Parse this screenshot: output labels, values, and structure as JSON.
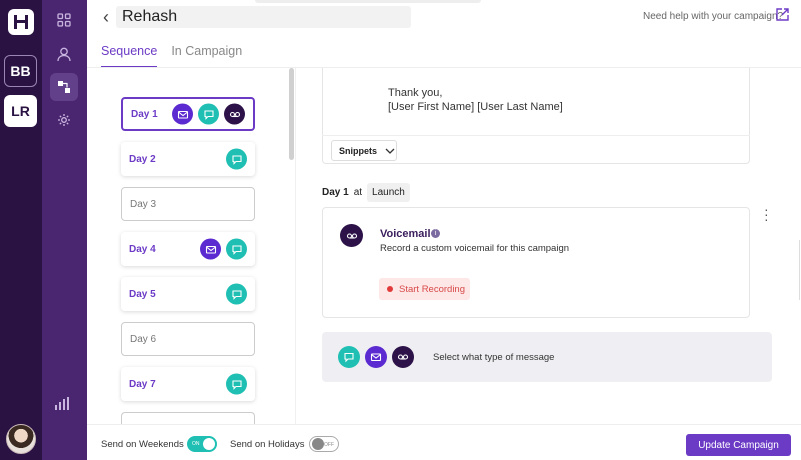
{
  "rail": {
    "workspaces": [
      "BB",
      "LR"
    ],
    "icons": [
      "logo-icon",
      "avatar"
    ]
  },
  "nav": {
    "icons": [
      "grid-icon",
      "user-icon",
      "sequence-icon",
      "settings-icon",
      "stats-icon"
    ]
  },
  "header": {
    "campaign_name": "Rehash",
    "help_text": "Need help with your campaign?"
  },
  "tabs": [
    {
      "label": "Sequence",
      "active": true
    },
    {
      "label": "In Campaign",
      "active": false
    }
  ],
  "days": [
    {
      "label": "Day 1",
      "icons": [
        "email",
        "text",
        "voicemail"
      ],
      "selected": true
    },
    {
      "label": "Day 2",
      "icons": [
        "text"
      ]
    },
    {
      "label": "Day 3",
      "icons": []
    },
    {
      "label": "Day 4",
      "icons": [
        "email",
        "text"
      ]
    },
    {
      "label": "Day 5",
      "icons": [
        "text"
      ]
    },
    {
      "label": "Day 6",
      "icons": []
    },
    {
      "label": "Day 7",
      "icons": [
        "text"
      ]
    }
  ],
  "email": {
    "signoff": "Thank you,",
    "signature": "[User First Name] [User Last Name]",
    "snippets_label": "Snippets"
  },
  "step": {
    "day_label": "Day 1",
    "at_label": "at",
    "time_label": "Launch"
  },
  "voicemail": {
    "title": "Voicemail",
    "description": "Record a custom voicemail for this campaign",
    "record_label": "Start Recording"
  },
  "picker": {
    "label": "Select what type of message"
  },
  "footer": {
    "weekends_label": "Send on Weekends",
    "weekends_toggle": "ON",
    "holidays_label": "Send on Holidays",
    "holidays_toggle": "OFF",
    "update_label": "Update Campaign"
  },
  "colors": {
    "accent": "#6c3bc6",
    "teal": "#1fbfb3",
    "dark": "#2c1248",
    "rail": "#2a1242",
    "nav": "#4a2570"
  }
}
